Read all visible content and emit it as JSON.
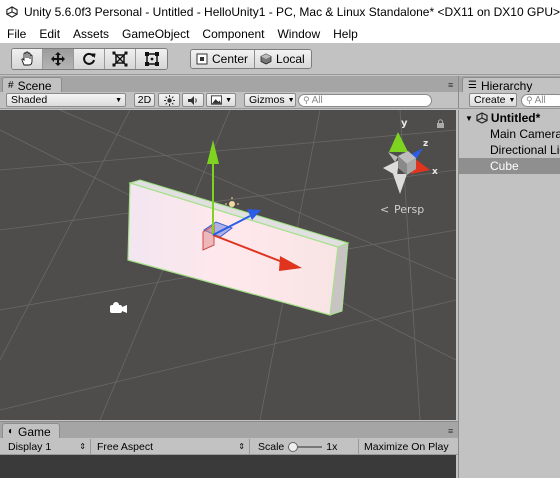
{
  "window": {
    "title": "Unity 5.6.0f3 Personal - Untitled - HelloUnity1 - PC, Mac & Linux Standalone* <DX11 on DX10 GPU>"
  },
  "menu": [
    "File",
    "Edit",
    "Assets",
    "GameObject",
    "Component",
    "Window",
    "Help"
  ],
  "toolbar": {
    "tools": [
      "hand-icon",
      "move-icon",
      "rotate-icon",
      "scale-icon",
      "rect-icon"
    ],
    "active_tool": "move-icon",
    "pivot_label": "Center",
    "space_label": "Local"
  },
  "scene": {
    "tab_label": "Scene",
    "shading_mode": "Shaded",
    "mode_2d_label": "2D",
    "gizmos_label": "Gizmos",
    "search_placeholder": "All",
    "persp_label": "Persp",
    "gizmo_axes": {
      "y": "y",
      "z": "z",
      "x": "x"
    }
  },
  "hierarchy": {
    "tab_label": "Hierarchy",
    "create_label": "Create",
    "search_placeholder": "All",
    "scene_name": "Untitled*",
    "items": [
      "Main Camera",
      "Directional Light",
      "Cube"
    ],
    "selected_item": "Cube"
  },
  "game": {
    "tab_label": "Game",
    "display": "Display 1",
    "aspect": "Free Aspect",
    "scale_label": "Scale",
    "scale_value": "1x",
    "maximize_label": "Maximize On Play"
  },
  "colors": {
    "editor_bg": "#c2c2c2",
    "scene_bg": "#4f4d4c",
    "axis_x": "#e0341f",
    "axis_y": "#7ed321",
    "axis_z": "#2a5de8",
    "selection": "#8f8f8f"
  }
}
